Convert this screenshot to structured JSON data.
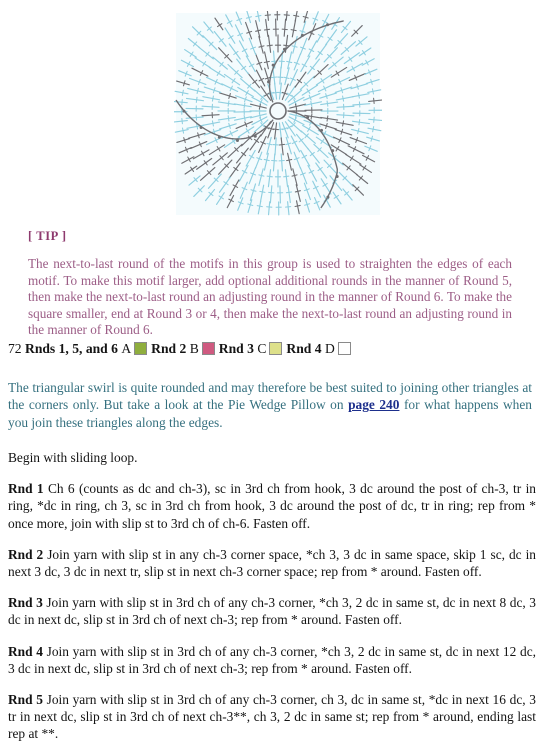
{
  "figure": {
    "name": "triangular-swirl-square-crochet-chart",
    "colors": {
      "stitch_blue": "#8fcfe0",
      "stitch_gray": "#6e6e72",
      "background": "#f4fbfd"
    }
  },
  "tip": {
    "label": "[ TIP ]",
    "text": "The next-to-last round of the motifs in this group is used to straighten the edges of each motif. To make this motif larger, add optional additional rounds in the manner of Round 5, then make the next-to-last round an adjusting round in the manner of Round 6. To make the square smaller, end at Round 3 or 4, then make the next-to-last round an adjusting round in the manner of Round 6.",
    "label_color": "#8e3a6e",
    "text_color": "#9c5d86"
  },
  "color_key": {
    "number": "72",
    "entries": [
      {
        "rounds": "Rnds 1, 5, and 6",
        "letter": "A",
        "swatch": "#8fae3e"
      },
      {
        "rounds": "Rnd 2",
        "letter": "B",
        "swatch": "#cf5a80"
      },
      {
        "rounds": "Rnd 3",
        "letter": "C",
        "swatch": "#dde08a"
      },
      {
        "rounds": "Rnd 4",
        "letter": "D",
        "swatch": "#ffffff"
      }
    ]
  },
  "swirl_note": {
    "part1": "The triangular swirl is quite rounded and may therefore be best suited to joining other triangles at the corners only. But take a look at the Pie Wedge Pillow on ",
    "link": "page 240",
    "part2": " for what happens when you join these triangles along the edges.",
    "text_color": "#35707f",
    "link_color": "#1d2f8c"
  },
  "instructions": {
    "begin": "Begin with sliding loop.",
    "rounds": [
      {
        "tag": "Rnd 1",
        "text": " Ch 6 (counts as dc and ch-3), sc in 3rd ch from hook, 3 dc around the post of ch-3, tr in ring, *dc in ring, ch 3, sc in 3rd ch from hook, 3 dc around the post of dc, tr in ring; rep from * once more, join with slip st to 3rd ch of ch-6. Fasten off."
      },
      {
        "tag": "Rnd 2",
        "text": " Join yarn with slip st in any ch-3 corner space, *ch 3, 3 dc in same space, skip 1 sc, dc in next 3 dc, 3 dc in next tr, slip st in next ch-3 corner space; rep from * around. Fasten off."
      },
      {
        "tag": "Rnd 3",
        "text": " Join yarn with slip st in 3rd ch of any ch-3 corner, *ch 3, 2 dc in same st, dc in next 8 dc, 3 dc in next dc, slip st in 3rd ch of next ch-3; rep from * around. Fasten off."
      },
      {
        "tag": "Rnd 4",
        "text": " Join yarn with slip st in 3rd ch of any ch-3 corner, *ch 3, 2 dc in same st, dc in next 12 dc, 3 dc in next dc, slip st in 3rd ch of next ch-3; rep from * around. Fasten off."
      },
      {
        "tag": "Rnd 5",
        "text": " Join yarn with slip st in 3rd ch of any ch-3 corner, ch 3, dc in same st, *dc in next 16 dc, 3 tr in next dc, slip st in 3rd ch of next ch-3**, ch 3, 2 dc in same st; rep from * around, ending last rep at **."
      }
    ]
  }
}
